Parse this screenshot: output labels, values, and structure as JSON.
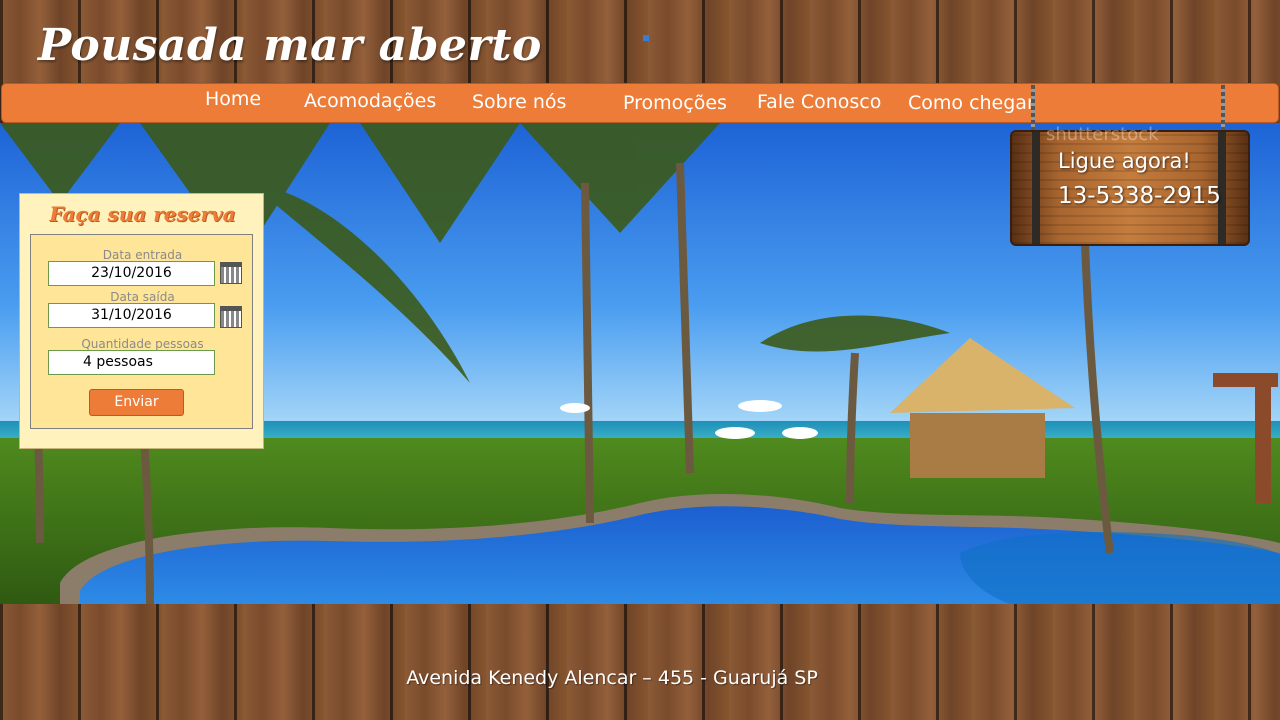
{
  "site": {
    "title": "Pousada mar aberto"
  },
  "nav": {
    "items": [
      {
        "label": "Home"
      },
      {
        "label": "Acomodações"
      },
      {
        "label": "Sobre nós"
      },
      {
        "label": "Promoções"
      },
      {
        "label": "Fale Conosco"
      },
      {
        "label": "Como chegar"
      }
    ]
  },
  "reservation": {
    "title": "Faça sua reserva",
    "checkin_label": "Data entrada",
    "checkin_value": "23/10/2016",
    "checkout_label": "Data saída",
    "checkout_value": "31/10/2016",
    "guests_label": "Quantidade pessoas",
    "guests_value": "4 pessoas",
    "submit_label": "Enviar"
  },
  "callout": {
    "line1": "Ligue agora!",
    "phone": "13-5338-2915",
    "watermark": "shutterstock"
  },
  "footer": {
    "address": "Avenida Kenedy Alencar – 455  - Guarujá SP"
  },
  "icons": {
    "calendar": "calendar-icon"
  },
  "colors": {
    "accent": "#ec7c37",
    "panel": "#fff2bd",
    "panel_inner": "#ffe597"
  }
}
